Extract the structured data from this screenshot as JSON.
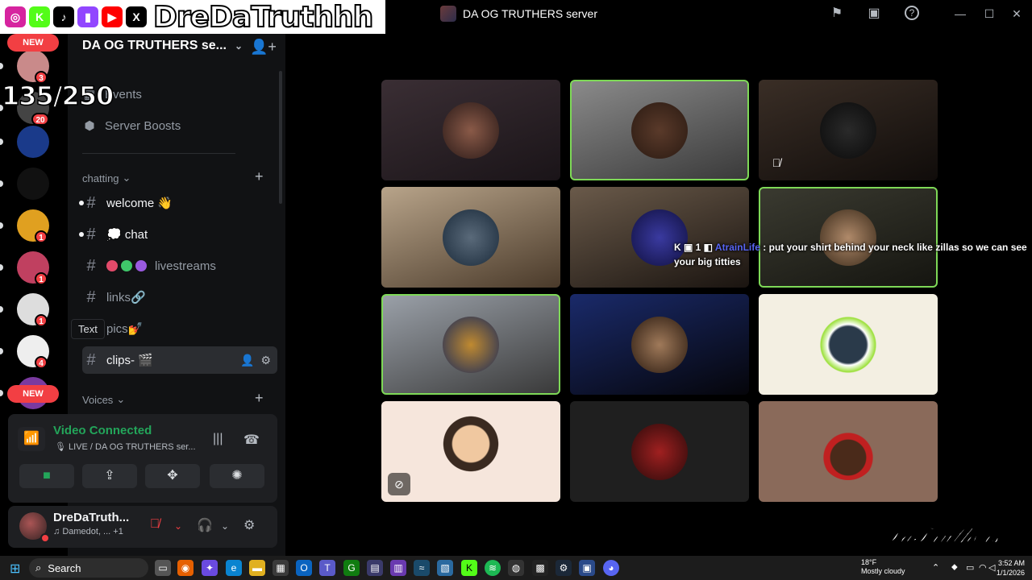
{
  "overlay": {
    "streamer_name": "DreDaTruthhh",
    "socials": [
      {
        "icon": "instagram-icon",
        "glyph": "◎",
        "color": "#d6249f"
      },
      {
        "icon": "kick-icon",
        "glyph": "K",
        "color": "#53fc18"
      },
      {
        "icon": "tiktok-icon",
        "glyph": "♪",
        "color": "#000000"
      },
      {
        "icon": "twitch-icon",
        "glyph": "▮",
        "color": "#9146ff"
      },
      {
        "icon": "youtube-icon",
        "glyph": "▶",
        "color": "#ff0000"
      },
      {
        "icon": "x-icon",
        "glyph": "X",
        "color": "#000000"
      }
    ],
    "counter": "135/250",
    "watermark": "DaTruthers"
  },
  "titlebar": {
    "server_title": "DA OG TRUTHERS server"
  },
  "rail": {
    "new_top": "NEW",
    "new_bottom": "NEW",
    "items": [
      {
        "icon": "server-avatar-1",
        "badge": "3",
        "color": "#c98a8a"
      },
      {
        "icon": "server-avatar-2",
        "badge": "20",
        "color": "#444"
      },
      {
        "icon": "server-avatar-n",
        "badge": "",
        "color": "#1a3a8a"
      },
      {
        "icon": "server-avatar-m",
        "badge": "",
        "color": "#111"
      },
      {
        "icon": "server-avatar-goku",
        "badge": "1",
        "color": "#e0a020"
      },
      {
        "icon": "server-avatar-anime",
        "badge": "1",
        "color": "#c04060"
      },
      {
        "icon": "server-avatar-beard",
        "badge": "1",
        "color": "#ddd"
      },
      {
        "icon": "server-avatar-squad",
        "badge": "4",
        "color": "#eee"
      },
      {
        "icon": "server-avatar-purple",
        "badge": "",
        "color": "#7a3aa0"
      }
    ]
  },
  "sidebar": {
    "server_name": "DA OG TRUTHERS se...",
    "events_label": "Events",
    "boosts_label": "Server Boosts",
    "category_chatting": "chatting",
    "category_voices": "Voices",
    "channels": [
      {
        "label": "welcome 👋",
        "unread": true
      },
      {
        "label": "💭 chat",
        "unread": true
      },
      {
        "label": "livestreams",
        "unread": false
      },
      {
        "label": "links🔗",
        "unread": false
      },
      {
        "label": "pics💅",
        "unread": false
      },
      {
        "label": "clips- 🎬",
        "unread": false
      }
    ],
    "tooltip": "Text"
  },
  "voice": {
    "status": "Video Connected",
    "channel": "LIVE / DA OG TRUTHERS ser..."
  },
  "user": {
    "name": "DreDaTruth...",
    "activity": "Damedot, ... +1"
  },
  "chat_overlay": {
    "badges": "K ▣ 1 ◧",
    "username": "AtrainLife",
    "message": ": put your shirt behind your neck like zillas so we can see your big titties"
  },
  "taskbar": {
    "search_placeholder": "Search",
    "weather_temp": "18°F",
    "weather_desc": "Mostly cloudy",
    "time": "3:52 AM",
    "date": "1/1/2026"
  }
}
